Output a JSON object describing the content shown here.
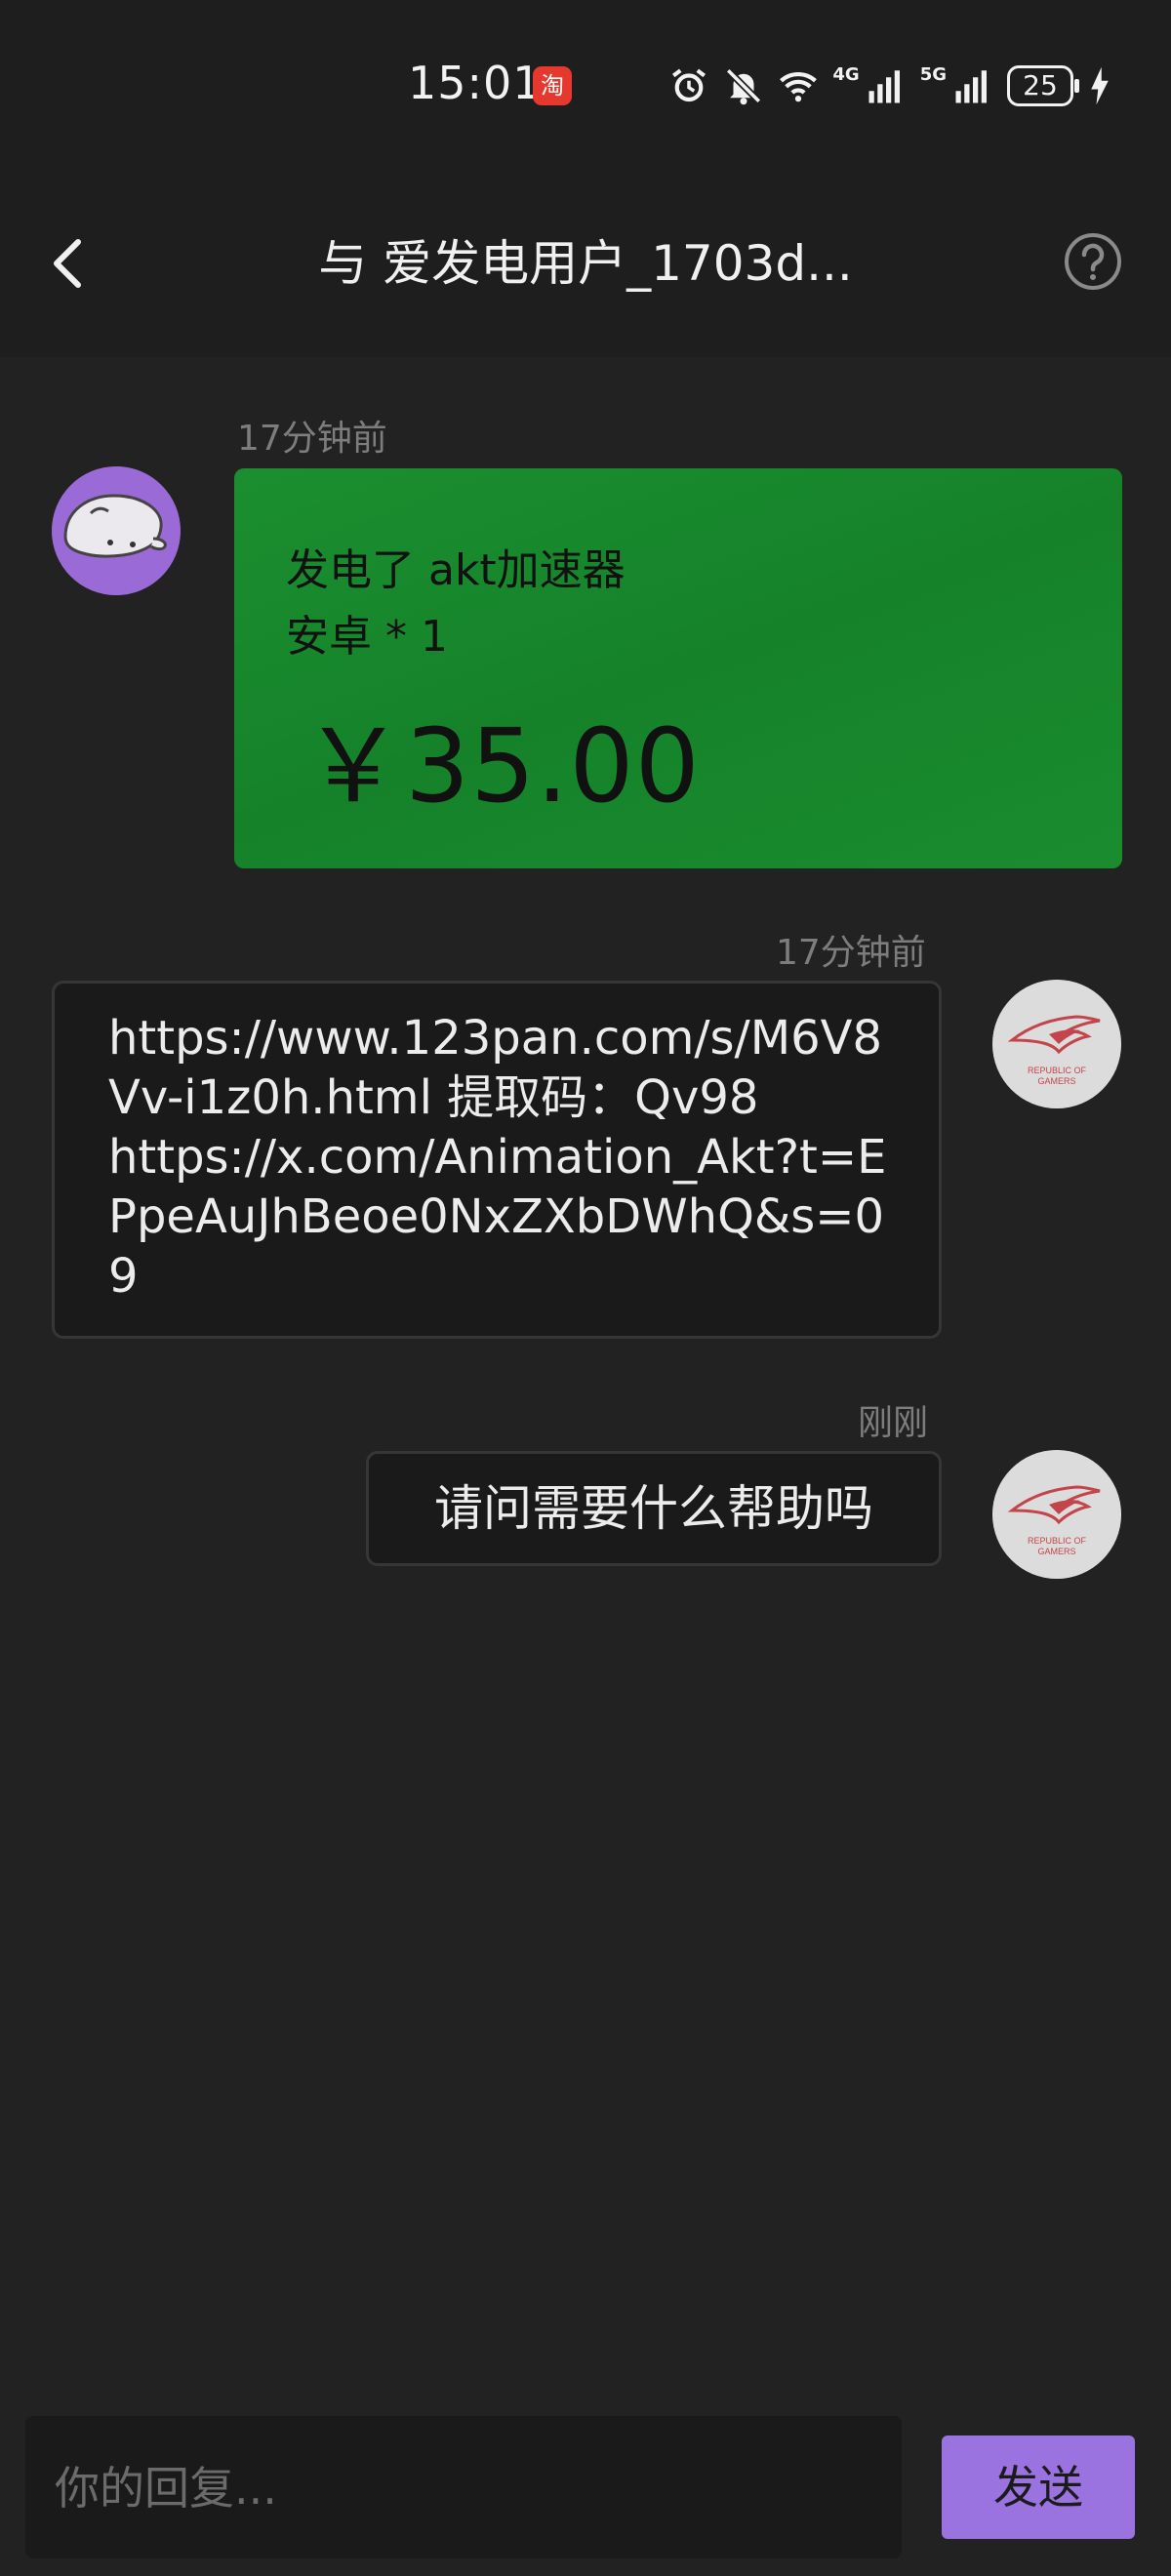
{
  "status_bar": {
    "time": "15:01",
    "taobao_badge": "淘",
    "net_4g": "4G",
    "net_5g": "5G",
    "battery": "25"
  },
  "header": {
    "title": "与 爱发电用户_1703d..."
  },
  "messages": [
    {
      "side": "left",
      "timestamp": "17分钟前",
      "type": "order-card",
      "line1": "发电了 akt加速器",
      "line2": "安卓 * 1",
      "amount": "￥35.00",
      "card_color": "#16852a"
    },
    {
      "side": "right",
      "timestamp": "17分钟前",
      "type": "text",
      "text": "https://www.123pan.com/s/M6V8Vv-i1z0h.html 提取码：Qv98\nhttps://x.com/Animation_Akt?t=EPpeAuJhBeoe0NxZXbDWhQ&s=09",
      "avatar_label": "REPUBLIC OF GAMERS"
    },
    {
      "side": "right",
      "timestamp": "刚刚",
      "type": "text",
      "text": "请问需要什么帮助吗",
      "avatar_label": "REPUBLIC OF GAMERS"
    }
  ],
  "composer": {
    "placeholder": "你的回复...",
    "send_label": "发送",
    "send_color": "#9a73e0"
  }
}
